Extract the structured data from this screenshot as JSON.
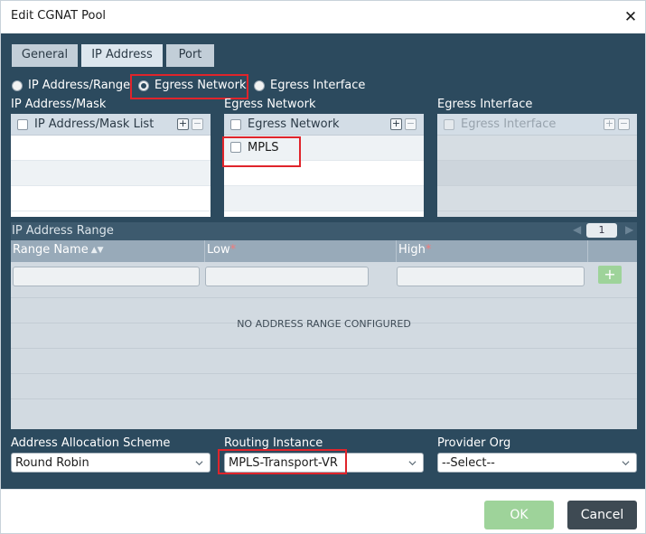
{
  "dialog": {
    "title": "Edit CGNAT Pool",
    "close_icon": "close-icon",
    "close_glyph": "✕"
  },
  "tabs": [
    {
      "label": "General",
      "active": false
    },
    {
      "label": "IP Address",
      "active": true
    },
    {
      "label": "Port",
      "active": false
    }
  ],
  "radios": [
    {
      "label": "IP Address/Range",
      "checked": false
    },
    {
      "label": "Egress Network",
      "checked": true
    },
    {
      "label": "Egress Interface",
      "checked": false
    }
  ],
  "ip_mask": {
    "section_label": "IP Address/Mask",
    "header": "IP Address/Mask List",
    "add_icon": "plus-icon",
    "remove_icon": "minus-icon"
  },
  "egress_network": {
    "section_label": "Egress Network",
    "header": "Egress Network",
    "rows": [
      "MPLS"
    ]
  },
  "egress_interface": {
    "section_label": "Egress Interface",
    "header": "Egress Interface",
    "disabled": true
  },
  "range": {
    "title": "IP Address Range",
    "page": "1",
    "columns": [
      {
        "label": "Range Name",
        "required": false,
        "sortable": true
      },
      {
        "label": "Low",
        "required": true
      },
      {
        "label": "High",
        "required": true
      }
    ],
    "add_glyph": "+",
    "empty_message": "NO ADDRESS RANGE CONFIGURED"
  },
  "allocation": {
    "label": "Address Allocation Scheme",
    "value": "Round Robin"
  },
  "routing_instance": {
    "label": "Routing Instance",
    "value": "MPLS-Transport-VR"
  },
  "provider_org": {
    "label": "Provider Org",
    "value": "--Select--"
  },
  "buttons": {
    "ok": "OK",
    "cancel": "Cancel"
  },
  "colors": {
    "panel_bg": "#2c4a5e",
    "ok_green": "#9ed39a",
    "cancel_dark": "#3e4a53",
    "highlight_red": "#e0242b"
  }
}
